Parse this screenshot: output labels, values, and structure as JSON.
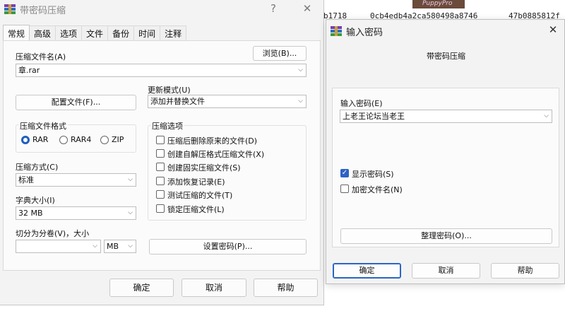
{
  "background": {
    "hash1": "b1718",
    "hash2": "0cb4edb4a2ca580498a8746",
    "hash3": "47b0885812f",
    "thumb_text": "PuppyPro"
  },
  "main": {
    "title": "带密码压缩",
    "help_glyph": "?",
    "close_glyph": "✕",
    "tabs": [
      "常规",
      "高级",
      "选项",
      "文件",
      "备份",
      "时间",
      "注释"
    ],
    "archive_name_label": "压缩文件名(A)",
    "browse_button": "浏览(B)...",
    "archive_name_value": "章.rar",
    "profiles_button": "配置文件(F)...",
    "update_mode_label": "更新模式(U)",
    "update_mode_value": "添加并替换文件",
    "format_group_label": "压缩文件格式",
    "formats": [
      "RAR",
      "RAR4",
      "ZIP"
    ],
    "format_selected": "RAR",
    "method_label": "压缩方式(C)",
    "method_value": "标准",
    "dict_label": "字典大小(I)",
    "dict_value": "32 MB",
    "split_label": "切分为分卷(V)，大小",
    "split_value": "",
    "split_unit": "MB",
    "options_group_label": "压缩选项",
    "options": [
      {
        "label": "压缩后删除原来的文件(D)",
        "checked": false
      },
      {
        "label": "创建自解压格式压缩文件(X)",
        "checked": false
      },
      {
        "label": "创建固实压缩文件(S)",
        "checked": false
      },
      {
        "label": "添加恢复记录(E)",
        "checked": false
      },
      {
        "label": "测试压缩的文件(T)",
        "checked": false
      },
      {
        "label": "锁定压缩文件(L)",
        "checked": false
      }
    ],
    "set_password_button": "设置密码(P)...",
    "ok": "确定",
    "cancel": "取消",
    "help": "帮助"
  },
  "password_dialog": {
    "title": "输入密码",
    "close_glyph": "✕",
    "subtitle": "带密码压缩",
    "enter_label": "输入密码(E)",
    "password_value": "上老王论坛当老王",
    "show_password": {
      "label": "显示密码(S)",
      "checked": true
    },
    "encrypt_names": {
      "label": "加密文件名(N)",
      "checked": false
    },
    "organize_button": "整理密码(O)...",
    "ok": "确定",
    "cancel": "取消",
    "help": "帮助"
  },
  "colors": {
    "accent": "#2b66c4",
    "dialog_bg": "#f3f3f3",
    "panel_bg": "#fbfbfb"
  }
}
